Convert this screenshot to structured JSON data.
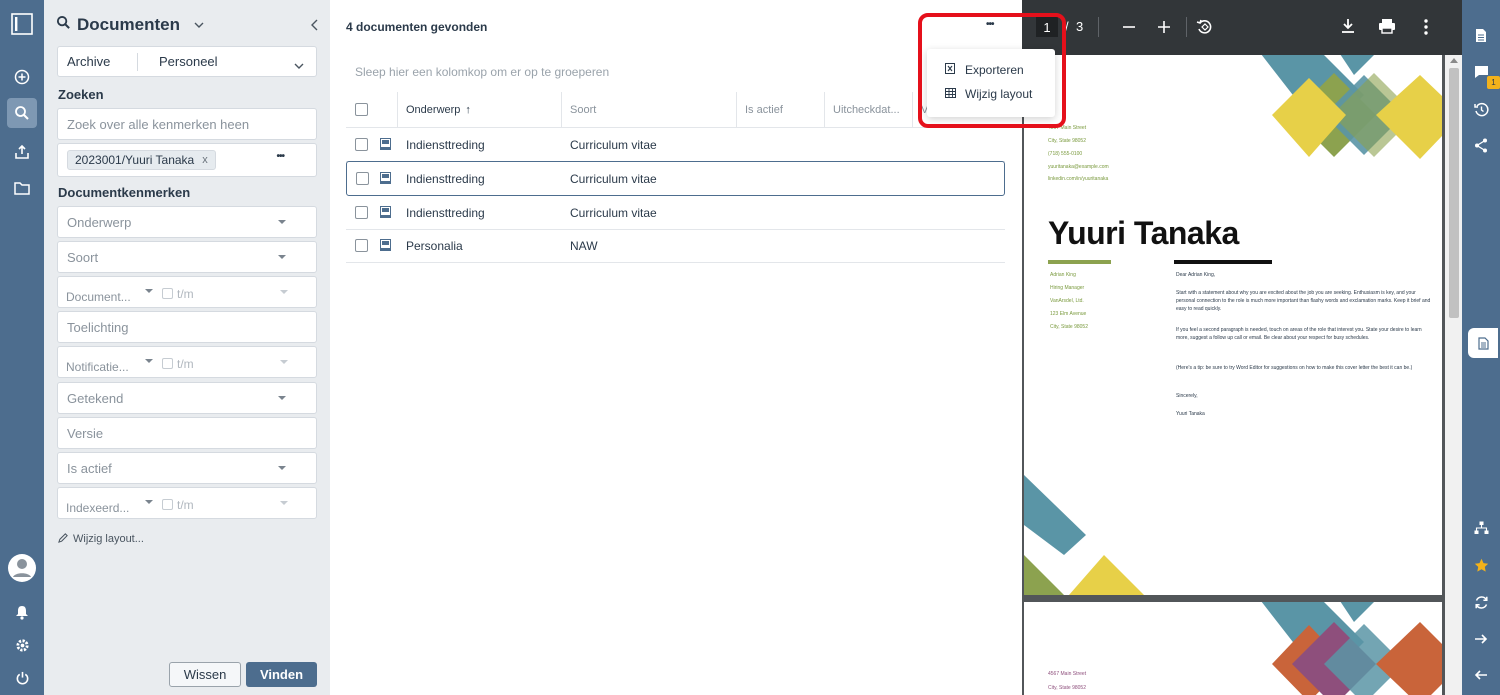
{
  "panel": {
    "title": "Documenten",
    "archive_label": "Archive",
    "archive_value": "Personeel",
    "search_section": "Zoeken",
    "search_placeholder": "Zoek over alle kenmerken heen",
    "search_token": "2023001/Yuuri Tanaka",
    "token_remove": "x",
    "more_label": "•••",
    "attributes_section": "Documentkenmerken",
    "fields": {
      "onderwerp": "Onderwerp",
      "soort": "Soort",
      "document_date": "Document...",
      "tm": "t/m",
      "toelichting": "Toelichting",
      "notificatie": "Notificatie...",
      "getekend": "Getekend",
      "versie": "Versie",
      "is_actief": "Is actief",
      "indexeerd": "Indexeerd..."
    },
    "edit_layout": "Wijzig layout...",
    "clear_button": "Wissen",
    "find_button": "Vinden"
  },
  "grid": {
    "count_text": "4 documenten gevonden",
    "more_label": "•••",
    "group_hint": "Sleep hier een kolomkop om er op te groeperen",
    "columns": {
      "onderwerp": "Onderwerp",
      "soort": "Soort",
      "is_actief": "Is actief",
      "uitcheckdatum": "Uitcheckdat...",
      "v": "V"
    },
    "sort_arrow": "↑",
    "rows": [
      {
        "onderwerp": "Indiensttreding",
        "soort": "Curriculum vitae"
      },
      {
        "onderwerp": "Indiensttreding",
        "soort": "Curriculum vitae"
      },
      {
        "onderwerp": "Indiensttreding",
        "soort": "Curriculum vitae"
      },
      {
        "onderwerp": "Personalia",
        "soort": "NAW"
      }
    ],
    "menu": {
      "export": "Exporteren",
      "layout": "Wijzig layout"
    }
  },
  "viewer": {
    "page_current": "1",
    "page_separator": "/",
    "page_total": "3",
    "doc": {
      "address": [
        "4567 Main Street",
        "City, State 98052",
        "(718) 555-0100",
        "yuuritanaka@example.com",
        "linkedin.com/in/yuuritanaka"
      ],
      "name": "Yuuri Tanaka",
      "recipient": [
        "Adrian King",
        "Hiring Manager",
        "VanArsdel, Ltd.",
        "123 Elm Avenue",
        "City, State 98052"
      ],
      "salutation": "Dear Adrian King,",
      "para1": "Start with a statement about why you are excited about the job you are seeking. Enthusiasm is key, and your personal connection to the role is much more important than flashy words and exclamation marks. Keep it brief and easy to read quickly.",
      "para2": "If you feel a second paragraph is needed, touch on areas of the role that interest you. State your desire to learn more, suggest a follow up call or email. Be clear about your respect for busy schedules.",
      "para3": "(Here's a tip: be sure to try Word Editor for suggestions on how to make this cover letter the best it can be.)",
      "closing": "Sincerely,",
      "signature": "Yuuri Tanaka",
      "page2_address": [
        "4567 Main Street",
        "City, State 98052"
      ]
    }
  },
  "right_rail": {
    "badge_count": "1"
  },
  "colors": {
    "rail": "#4d6d8e",
    "highlight": "#e5101b",
    "teal": "#5a95a6",
    "olive": "#8ca24f",
    "yellow": "#e7d048",
    "orange": "#c9643a",
    "purple": "#8e4f7c",
    "star": "#f3b21b"
  }
}
